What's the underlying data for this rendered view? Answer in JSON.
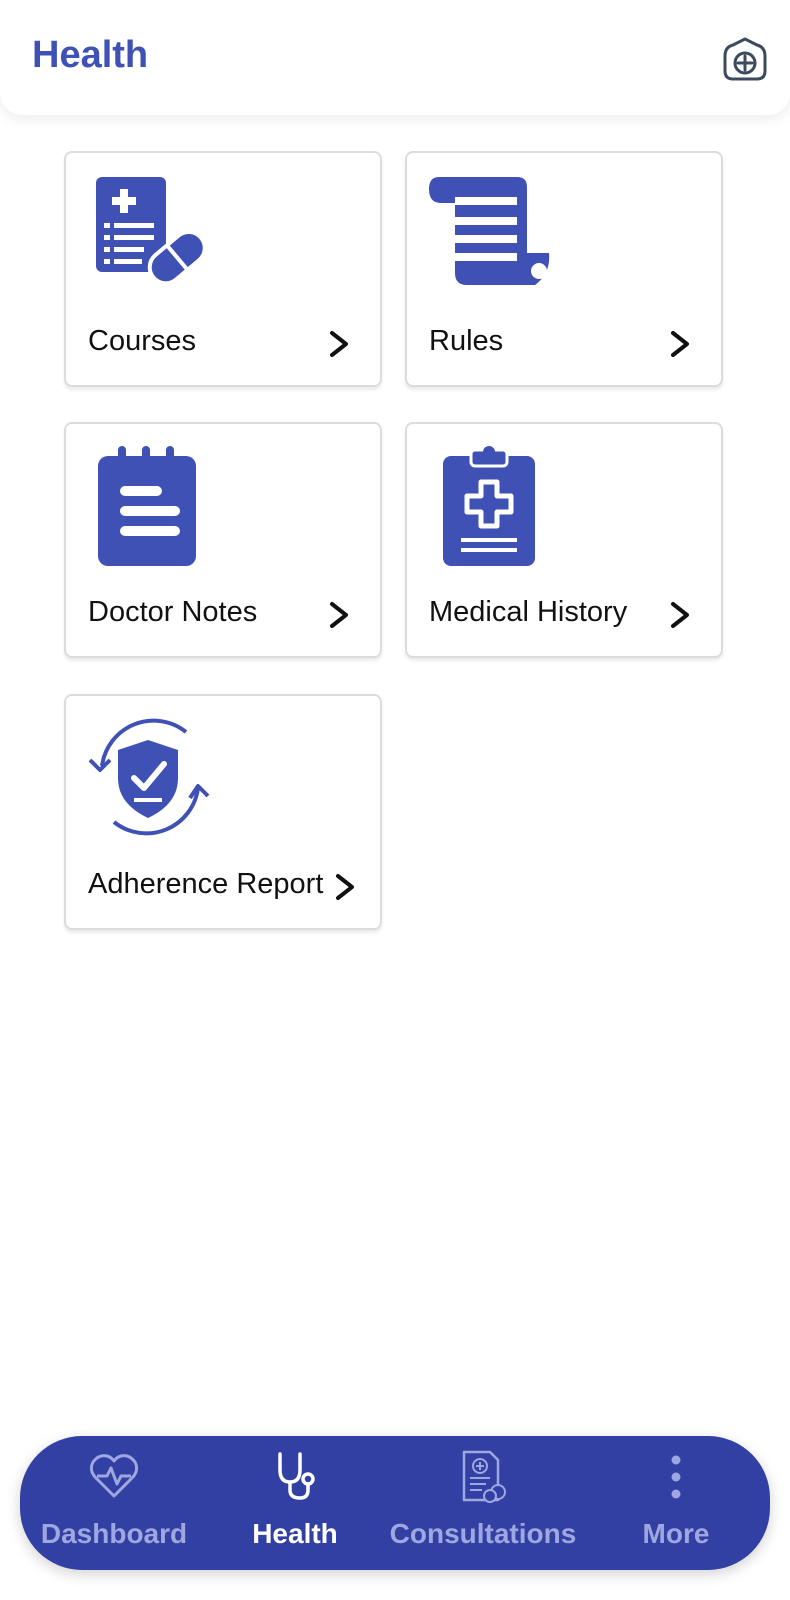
{
  "header": {
    "title": "Health",
    "action_icon": "add-square-icon"
  },
  "cards": [
    {
      "label": "Courses",
      "icon": "medical-prescription-icon"
    },
    {
      "label": "Rules",
      "icon": "scroll-icon"
    },
    {
      "label": "Doctor Notes",
      "icon": "notepad-icon"
    },
    {
      "label": "Medical History",
      "icon": "medical-clipboard-icon"
    },
    {
      "label": "Adherence Report",
      "icon": "shield-check-icon"
    }
  ],
  "nav": {
    "items": [
      {
        "label": "Dashboard",
        "icon": "heartbeat-icon",
        "active": false
      },
      {
        "label": "Health",
        "icon": "stethoscope-icon",
        "active": true
      },
      {
        "label": "Consultations",
        "icon": "prescription-document-icon",
        "active": false
      },
      {
        "label": "More",
        "icon": "more-vertical-icon",
        "active": false
      }
    ]
  },
  "colors": {
    "accent": "#3f51b5",
    "nav_background": "#3340a3",
    "nav_inactive": "#9fa7e0",
    "nav_active": "#ffffff"
  }
}
